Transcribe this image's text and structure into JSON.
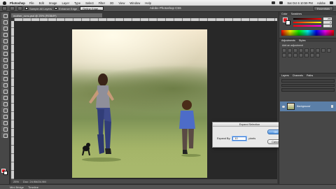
{
  "menubar": {
    "app_name": "Photoshop",
    "items": [
      "File",
      "Edit",
      "Image",
      "Layer",
      "Type",
      "Select",
      "Filter",
      "3D",
      "View",
      "Window",
      "Help"
    ],
    "clock": "Sat Oct 6 10:59 PM",
    "user": "Adobe"
  },
  "optionsbar": {
    "sample_all_layers": "Sample All Layers",
    "enhance_edge": "Enhance Edge",
    "refine_edge": "Refine Edge...",
    "window_title": "Adobe Photoshop CS6",
    "workspace": "Essentials"
  },
  "document": {
    "tab_title": "mother_runs.psd @ 25% (RGB/8*)",
    "zoom": "25%",
    "doc_info": "Doc: 24.9M/24.9M"
  },
  "dialog": {
    "title": "Expand Selection",
    "expand_label": "Expand By:",
    "expand_value": "10",
    "unit": "pixels",
    "ok": "OK",
    "cancel": "Cancel"
  },
  "panels": {
    "color_tabs": [
      "Color",
      "Swatches"
    ],
    "rgb_values": [
      "255",
      "0",
      "0"
    ],
    "adjustments_tabs": [
      "Adjustments",
      "Styles"
    ],
    "adjustments_label": "Add an adjustment",
    "layers_tabs": [
      "Layers",
      "Channels",
      "Paths"
    ],
    "layer_name": "Background"
  },
  "bottom_tabs": [
    "Mini Bridge",
    "Timeline"
  ],
  "colors": {
    "foreground": "#e01b24",
    "background": "#ffffff",
    "selected_layer": "#5b7fa8",
    "ok_button": "#4c92e0"
  }
}
